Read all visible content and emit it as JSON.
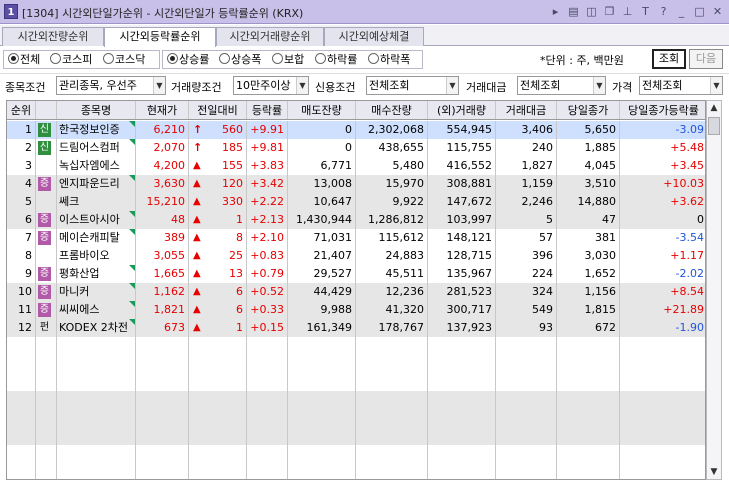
{
  "window": {
    "number": "1",
    "title": "[1304] 시간외단일가순위 - 시간외단일가 등락률순위 (KRX)"
  },
  "tabs": [
    "시간외잔량순위",
    "시간외등락률순위",
    "시간외거래량순위",
    "시간외예상체결"
  ],
  "market_radios": [
    "전체",
    "코스피",
    "코스닥"
  ],
  "sort_radios": [
    "상승률",
    "상승폭",
    "보합",
    "하락률",
    "하락폭"
  ],
  "unit_label": "*단위 : 주, 백만원",
  "buttons": {
    "query": "조회",
    "next": "다음"
  },
  "filters": {
    "stock_cond_label": "종목조건",
    "stock_cond_value": "관리종목, 우선주",
    "volume_cond_label": "거래량조건",
    "volume_cond_value": "10만주이상",
    "credit_cond_label": "신용조건",
    "credit_cond_value": "전체조회",
    "amount_label": "거래대금",
    "amount_value": "전체조회",
    "price_label": "가격",
    "price_value": "전체조회"
  },
  "columns": [
    "순위",
    "",
    "종목명",
    "현재가",
    "전일대비",
    "등락률",
    "매도잔량",
    "매수잔량",
    "(외)거래량",
    "거래대금",
    "당일종가",
    "당일종가등락률"
  ],
  "rows": [
    {
      "rank": "1",
      "badge": "신",
      "name": "한국정보인증",
      "price": "6,210",
      "arrow": "up",
      "diff": "560",
      "rate": "+9.91",
      "sell": "0",
      "buy": "2,302,068",
      "volume": "554,945",
      "amount": "3,406",
      "close": "5,650",
      "close_rate": "-3.09"
    },
    {
      "rank": "2",
      "badge": "신",
      "name": "드림어스컴퍼",
      "price": "2,070",
      "arrow": "up",
      "diff": "185",
      "rate": "+9.81",
      "sell": "0",
      "buy": "438,655",
      "volume": "115,755",
      "amount": "240",
      "close": "1,885",
      "close_rate": "+5.48"
    },
    {
      "rank": "3",
      "badge": "",
      "name": "녹십자엠에스",
      "price": "4,200",
      "arrow": "tri",
      "diff": "155",
      "rate": "+3.83",
      "sell": "6,771",
      "buy": "5,480",
      "volume": "416,552",
      "amount": "1,827",
      "close": "4,045",
      "close_rate": "+3.45"
    },
    {
      "rank": "4",
      "badge": "증",
      "name": "엔지파운드리",
      "price": "3,630",
      "arrow": "tri",
      "diff": "120",
      "rate": "+3.42",
      "sell": "13,008",
      "buy": "15,970",
      "volume": "308,881",
      "amount": "1,159",
      "close": "3,510",
      "close_rate": "+10.03"
    },
    {
      "rank": "5",
      "badge": "",
      "name": "쎄크",
      "price": "15,210",
      "arrow": "tri",
      "diff": "330",
      "rate": "+2.22",
      "sell": "10,647",
      "buy": "9,922",
      "volume": "147,672",
      "amount": "2,246",
      "close": "14,880",
      "close_rate": "+3.62"
    },
    {
      "rank": "6",
      "badge": "증",
      "name": "이스트아시아",
      "price": "48",
      "arrow": "tri",
      "diff": "1",
      "rate": "+2.13",
      "sell": "1,430,944",
      "buy": "1,286,812",
      "volume": "103,997",
      "amount": "5",
      "close": "47",
      "close_rate": "0"
    },
    {
      "rank": "7",
      "badge": "증",
      "name": "메이슨캐피탈",
      "price": "389",
      "arrow": "tri",
      "diff": "8",
      "rate": "+2.10",
      "sell": "71,031",
      "buy": "115,612",
      "volume": "148,121",
      "amount": "57",
      "close": "381",
      "close_rate": "-3.54"
    },
    {
      "rank": "8",
      "badge": "",
      "name": "프롬바이오",
      "price": "3,055",
      "arrow": "tri",
      "diff": "25",
      "rate": "+0.83",
      "sell": "21,407",
      "buy": "24,883",
      "volume": "128,715",
      "amount": "396",
      "close": "3,030",
      "close_rate": "+1.17"
    },
    {
      "rank": "9",
      "badge": "증",
      "name": "평화산업",
      "price": "1,665",
      "arrow": "tri",
      "diff": "13",
      "rate": "+0.79",
      "sell": "29,527",
      "buy": "45,511",
      "volume": "135,967",
      "amount": "224",
      "close": "1,652",
      "close_rate": "-2.02"
    },
    {
      "rank": "10",
      "badge": "증",
      "name": "마니커",
      "price": "1,162",
      "arrow": "tri",
      "diff": "6",
      "rate": "+0.52",
      "sell": "44,429",
      "buy": "12,236",
      "volume": "281,523",
      "amount": "324",
      "close": "1,156",
      "close_rate": "+8.54"
    },
    {
      "rank": "11",
      "badge": "증",
      "name": "씨씨에스",
      "price": "1,821",
      "arrow": "tri",
      "diff": "6",
      "rate": "+0.33",
      "sell": "9,988",
      "buy": "41,320",
      "volume": "300,717",
      "amount": "549",
      "close": "1,815",
      "close_rate": "+21.89"
    },
    {
      "rank": "12",
      "badge": "펀",
      "name": "KODEX 2차전",
      "price": "673",
      "arrow": "tri",
      "diff": "1",
      "rate": "+0.15",
      "sell": "161,349",
      "buy": "178,767",
      "volume": "137,923",
      "amount": "93",
      "close": "672",
      "close_rate": "-1.90"
    }
  ],
  "colors": {
    "up": "#e60000",
    "down": "#1f55d8",
    "selected": "#cfe0ff",
    "band": "#e6e6e6"
  }
}
